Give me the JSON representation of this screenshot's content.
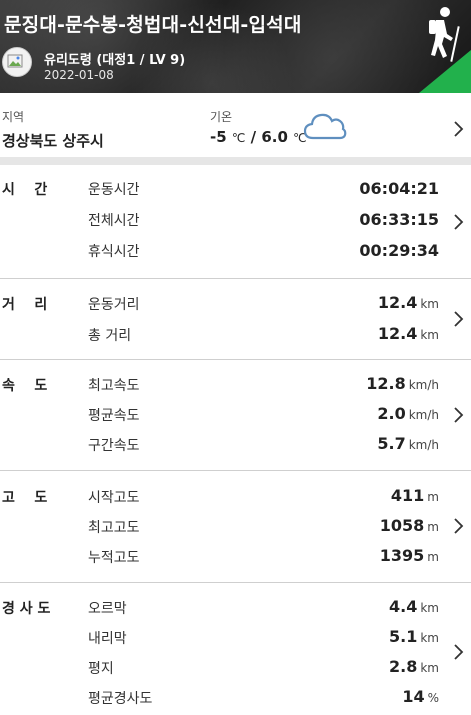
{
  "header": {
    "route_title": "문징대-문수봉-청법대-신선대-입석대",
    "user_name": "유리도령 (대정1 / LV 9)",
    "date": "2022-01-08",
    "badge_color": "#22b14c"
  },
  "weather": {
    "region_label": "지역",
    "region_value": "경상북도 상주시",
    "temp_label": "기온",
    "temp_low": "-5",
    "temp_high": "6.0",
    "temp_unit": "℃",
    "temp_sep": "/",
    "icon": "cloud-icon"
  },
  "sections": {
    "time": {
      "label": "시    간",
      "rows": [
        {
          "label": "운동시간",
          "value": "06:04:21"
        },
        {
          "label": "전체시간",
          "value": "06:33:15"
        },
        {
          "label": "휴식시간",
          "value": "00:29:34"
        }
      ]
    },
    "distance": {
      "label": "거    리",
      "rows": [
        {
          "label": "운동거리",
          "value": "12.4",
          "unit": "km"
        },
        {
          "label": "총 거리",
          "value": "12.4",
          "unit": "km"
        }
      ]
    },
    "speed": {
      "label": "속    도",
      "rows": [
        {
          "label": "최고속도",
          "value": "12.8",
          "unit": "km/h"
        },
        {
          "label": "평균속도",
          "value": "2.0",
          "unit": "km/h"
        },
        {
          "label": "구간속도",
          "value": "5.7",
          "unit": "km/h"
        }
      ]
    },
    "altitude": {
      "label": "고    도",
      "rows": [
        {
          "label": "시작고도",
          "value": "411",
          "unit": "m"
        },
        {
          "label": "최고고도",
          "value": "1058",
          "unit": "m"
        },
        {
          "label": "누적고도",
          "value": "1395",
          "unit": "m"
        }
      ]
    },
    "slope": {
      "label": "경 사 도",
      "rows": [
        {
          "label": "오르막",
          "value": "4.4",
          "unit": "km"
        },
        {
          "label": "내리막",
          "value": "5.1",
          "unit": "km"
        },
        {
          "label": "평지",
          "value": "2.8",
          "unit": "km"
        },
        {
          "label": "평균경사도",
          "value": "14",
          "unit": "%"
        }
      ]
    }
  }
}
